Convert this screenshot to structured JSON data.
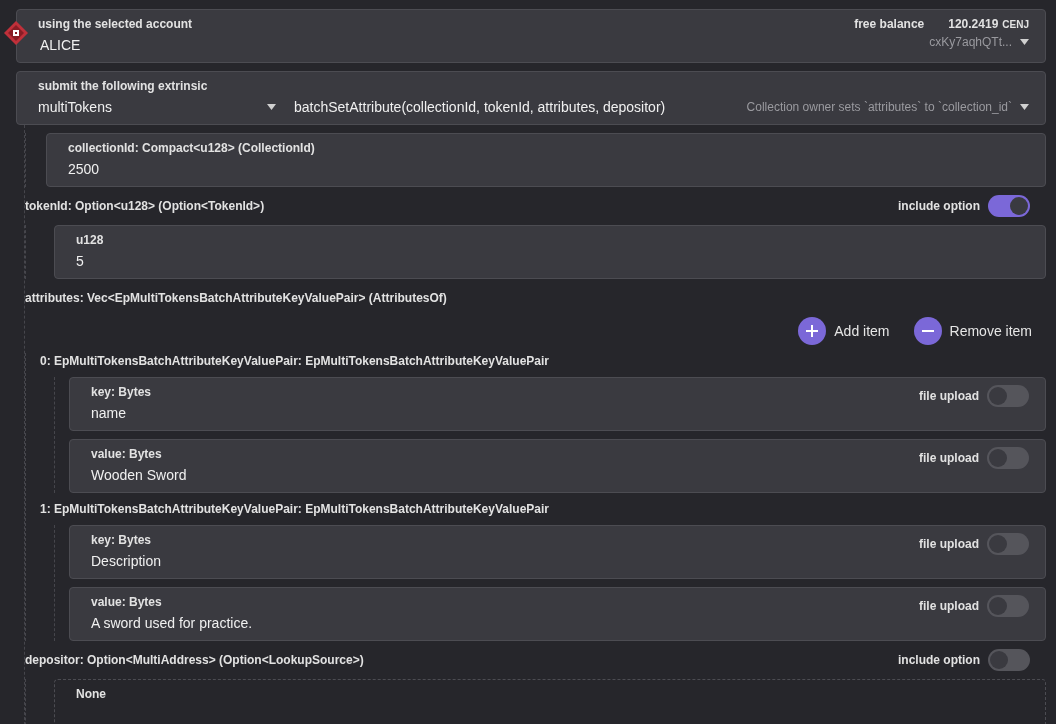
{
  "account": {
    "label": "using the selected account",
    "name": "ALICE",
    "balance_label": "free balance",
    "balance_value": "120.2419",
    "balance_unit": "CENJ",
    "address": "cxKy7aqhQTt..."
  },
  "extrinsic": {
    "label": "submit the following extrinsic",
    "section": "multiTokens",
    "method": "batchSetAttribute(collectionId, tokenId, attributes, depositor)",
    "description": "Collection owner sets `attributes` to `collection_id`"
  },
  "params": [
    {
      "kind": "input",
      "label": "collectionId: Compact<u128> (CollectionId)",
      "value": "2500"
    },
    {
      "kind": "option",
      "label": "tokenId: Option<u128> (Option<TokenId>)",
      "toggle_label": "include option",
      "on": true,
      "inner": {
        "label": "u128",
        "value": "5"
      }
    },
    {
      "kind": "vec",
      "label": "attributes: Vec<EpMultiTokensBatchAttributeKeyValuePair> (AttributesOf)",
      "buttons": [
        {
          "kind": "add",
          "label": "Add item"
        },
        {
          "kind": "remove",
          "label": "Remove item"
        }
      ],
      "items": [
        {
          "label": "0: EpMultiTokensBatchAttributeKeyValuePair: EpMultiTokensBatchAttributeKeyValuePair",
          "fields": [
            {
              "label": "key: Bytes",
              "value": "name",
              "toggle_label": "file upload",
              "on": false
            },
            {
              "label": "value: Bytes",
              "value": "Wooden Sword",
              "toggle_label": "file upload",
              "on": false
            }
          ]
        },
        {
          "label": "1: EpMultiTokensBatchAttributeKeyValuePair: EpMultiTokensBatchAttributeKeyValuePair",
          "fields": [
            {
              "label": "key: Bytes",
              "value": "Description",
              "toggle_label": "file upload",
              "on": false
            },
            {
              "label": "value: Bytes",
              "value": "A sword used for practice.",
              "toggle_label": "file upload",
              "on": false
            }
          ]
        }
      ]
    },
    {
      "kind": "option",
      "label": "depositor: Option<MultiAddress> (Option<LookupSource>)",
      "toggle_label": "include option",
      "on": false,
      "inner": {
        "label": "None"
      }
    }
  ]
}
